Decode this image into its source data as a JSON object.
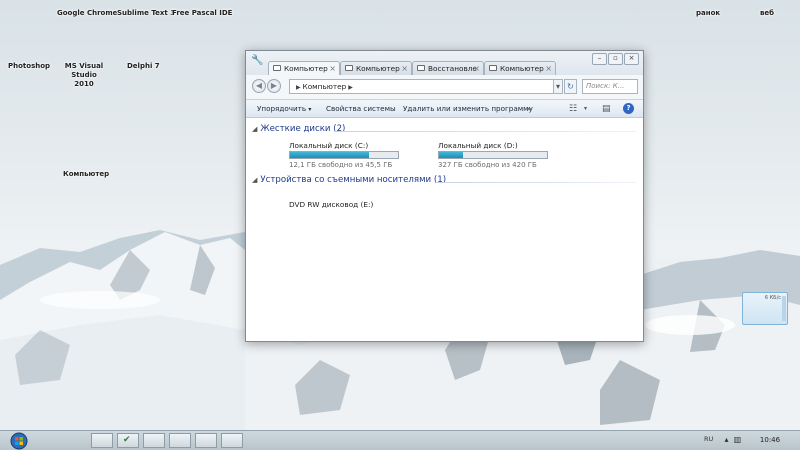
{
  "desktop": {
    "top_labels": [
      "Google Chrome",
      "Sublime Text 3",
      "Free Pascal IDE"
    ],
    "top_right_labels": [
      "ранок",
      "веб"
    ],
    "icons": [
      "Photoshop",
      "MS Visual Studio 2010",
      "Delphi 7"
    ],
    "computer_label": "Компьютер"
  },
  "window": {
    "tabs": [
      {
        "label": "Компьютер",
        "active": true
      },
      {
        "label": "Компьютер",
        "active": false
      },
      {
        "label": "Восстановле",
        "active": false
      },
      {
        "label": "Компьютер",
        "active": false
      }
    ],
    "address": "Компьютер",
    "search_placeholder": "Поиск: К...",
    "commands": [
      "Упорядочить",
      "Свойства системы",
      "Удалить или изменить программу",
      "»"
    ],
    "groups": [
      {
        "title": "Жесткие диски (2)",
        "drives": [
          {
            "name": "Локальный диск (C:)",
            "free": "12,1 ГБ свободно из 45,5 ГБ",
            "used_fraction": 0.73
          },
          {
            "name": "Локальный диск (D:)",
            "free": "327 ГБ свободно из 420 ГБ",
            "used_fraction": 0.22
          }
        ]
      },
      {
        "title": "Устройства со съемными носителями (1)",
        "drives": [
          {
            "name": "DVD RW дисковод (E:)"
          }
        ]
      }
    ]
  },
  "gadget": {
    "text": "6 КБ/с"
  },
  "taskbar": {
    "lang": "RU",
    "clock": "10:46"
  },
  "colors": {
    "accent_blue": "#1e3a8a",
    "bar_fill": "#1e8fb4",
    "help_icon": "#2f66c4"
  }
}
